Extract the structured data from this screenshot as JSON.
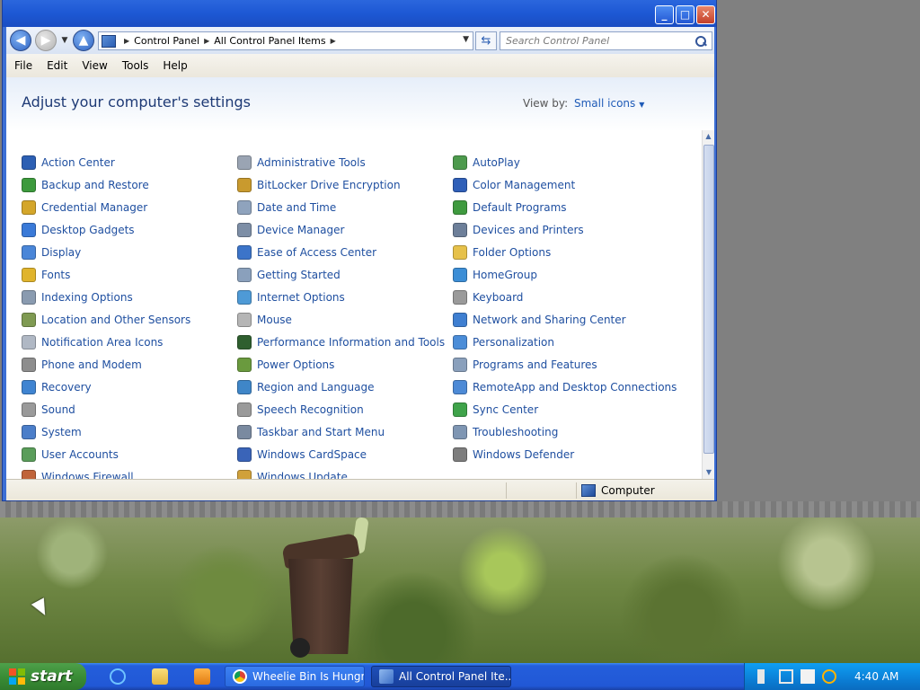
{
  "window": {
    "address": {
      "crumbs": [
        "Control Panel",
        "All Control Panel Items"
      ]
    },
    "search": {
      "placeholder": "Search Control Panel"
    },
    "menu": [
      "File",
      "Edit",
      "View",
      "Tools",
      "Help"
    ],
    "title": "Adjust your computer's settings",
    "view_by": {
      "label": "View by:",
      "value": "Small icons"
    },
    "items": {
      "col1": [
        {
          "label": "Action Center",
          "icon": "flag-icon",
          "color": "#2c5fb3"
        },
        {
          "label": "Backup and Restore",
          "icon": "backup-icon",
          "color": "#3c9a3c"
        },
        {
          "label": "Credential Manager",
          "icon": "vault-icon",
          "color": "#d4a62a"
        },
        {
          "label": "Desktop Gadgets",
          "icon": "gadgets-icon",
          "color": "#3a7ad8"
        },
        {
          "label": "Display",
          "icon": "display-icon",
          "color": "#4a86d8"
        },
        {
          "label": "Fonts",
          "icon": "fonts-icon",
          "color": "#e0b42c"
        },
        {
          "label": "Indexing Options",
          "icon": "indexing-icon",
          "color": "#8a9bb0"
        },
        {
          "label": "Location and Other Sensors",
          "icon": "sensors-icon",
          "color": "#7f9a52"
        },
        {
          "label": "Notification Area Icons",
          "icon": "notification-icon",
          "color": "#b0b8c4"
        },
        {
          "label": "Phone and Modem",
          "icon": "phone-icon",
          "color": "#8d8d8d"
        },
        {
          "label": "Recovery",
          "icon": "recovery-icon",
          "color": "#3f84d1"
        },
        {
          "label": "Sound",
          "icon": "sound-icon",
          "color": "#9a9a9a"
        },
        {
          "label": "System",
          "icon": "system-icon",
          "color": "#4b7ec9"
        },
        {
          "label": "User Accounts",
          "icon": "users-icon",
          "color": "#5a9d5a"
        },
        {
          "label": "Windows Firewall",
          "icon": "firewall-icon",
          "color": "#c0643a"
        }
      ],
      "col2": [
        {
          "label": "Administrative Tools",
          "icon": "admin-tools-icon",
          "color": "#9aa4b3"
        },
        {
          "label": "BitLocker Drive Encryption",
          "icon": "bitlocker-icon",
          "color": "#c99a2e"
        },
        {
          "label": "Date and Time",
          "icon": "clock-icon",
          "color": "#8fa3bd"
        },
        {
          "label": "Device Manager",
          "icon": "device-manager-icon",
          "color": "#7d8ea6"
        },
        {
          "label": "Ease of Access Center",
          "icon": "ease-of-access-icon",
          "color": "#3c74c9"
        },
        {
          "label": "Getting Started",
          "icon": "getting-started-icon",
          "color": "#8aa0bc"
        },
        {
          "label": "Internet Options",
          "icon": "internet-icon",
          "color": "#4e9ad6"
        },
        {
          "label": "Mouse",
          "icon": "mouse-icon",
          "color": "#b5b5b5"
        },
        {
          "label": "Performance Information and Tools",
          "icon": "performance-icon",
          "color": "#2f5f2f"
        },
        {
          "label": "Power Options",
          "icon": "power-icon",
          "color": "#6a9a3e"
        },
        {
          "label": "Region and Language",
          "icon": "globe-icon",
          "color": "#3f86c8"
        },
        {
          "label": "Speech Recognition",
          "icon": "microphone-icon",
          "color": "#9a9a9a"
        },
        {
          "label": "Taskbar and Start Menu",
          "icon": "taskbar-icon",
          "color": "#7a8aa0"
        },
        {
          "label": "Windows CardSpace",
          "icon": "cardspace-icon",
          "color": "#3a64b8"
        },
        {
          "label": "Windows Update",
          "icon": "update-icon",
          "color": "#d0a13a"
        }
      ],
      "col3": [
        {
          "label": "AutoPlay",
          "icon": "autoplay-icon",
          "color": "#4d9a4d"
        },
        {
          "label": "Color Management",
          "icon": "color-management-icon",
          "color": "#2f5fb8"
        },
        {
          "label": "Default Programs",
          "icon": "default-programs-icon",
          "color": "#3f9a3f"
        },
        {
          "label": "Devices and Printers",
          "icon": "printer-icon",
          "color": "#6d7f99"
        },
        {
          "label": "Folder Options",
          "icon": "folder-icon",
          "color": "#e6c14a"
        },
        {
          "label": "HomeGroup",
          "icon": "homegroup-icon",
          "color": "#3c8ed6"
        },
        {
          "label": "Keyboard",
          "icon": "keyboard-icon",
          "color": "#9a9a9a"
        },
        {
          "label": "Network and Sharing Center",
          "icon": "network-icon",
          "color": "#3f7fd1"
        },
        {
          "label": "Personalization",
          "icon": "personalization-icon",
          "color": "#4b8dd8"
        },
        {
          "label": "Programs and Features",
          "icon": "programs-icon",
          "color": "#8aa0bc"
        },
        {
          "label": "RemoteApp and Desktop Connections",
          "icon": "remoteapp-icon",
          "color": "#4d8ad6"
        },
        {
          "label": "Sync Center",
          "icon": "sync-icon",
          "color": "#3fa34a"
        },
        {
          "label": "Troubleshooting",
          "icon": "troubleshooting-icon",
          "color": "#7f96b3"
        },
        {
          "label": "Windows Defender",
          "icon": "defender-icon",
          "color": "#7d7d7d"
        }
      ]
    },
    "status": {
      "computer": "Computer"
    }
  },
  "desktop": {
    "overlay_percent": "0%",
    "overlay_color": "#2e9fe0"
  },
  "taskbar": {
    "start_label": "start",
    "tasks": [
      {
        "label": "Wheelie Bin Is Hungr..."
      },
      {
        "label": "All Control Panel Ite..."
      }
    ],
    "clock": "4:40 AM"
  }
}
